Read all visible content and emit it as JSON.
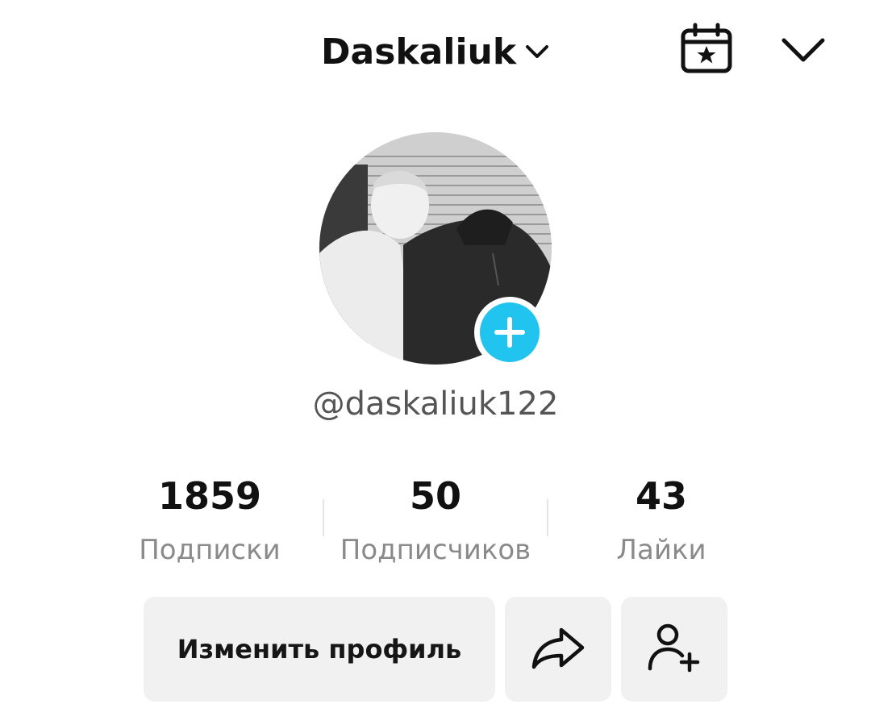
{
  "header": {
    "account_name": "Daskaliuk",
    "account_chevron_icon": "chevron-down-icon",
    "calendar_icon": "calendar-star-icon",
    "menu_icon": "chevron-down-icon"
  },
  "profile": {
    "avatar_description": "profile-photo",
    "add_icon": "plus-icon",
    "username": "@daskaliuk122"
  },
  "stats": [
    {
      "value": "1859",
      "label": "Подписки"
    },
    {
      "value": "50",
      "label": "Подписчиков"
    },
    {
      "value": "43",
      "label": "Лайки"
    }
  ],
  "actions": {
    "edit_label": "Изменить профиль",
    "share_icon": "share-arrow-icon",
    "add_friend_icon": "add-user-icon"
  },
  "colors": {
    "accent": "#20c4ee",
    "button_bg": "#f1f1f2",
    "muted_text": "#8a8a8a"
  }
}
